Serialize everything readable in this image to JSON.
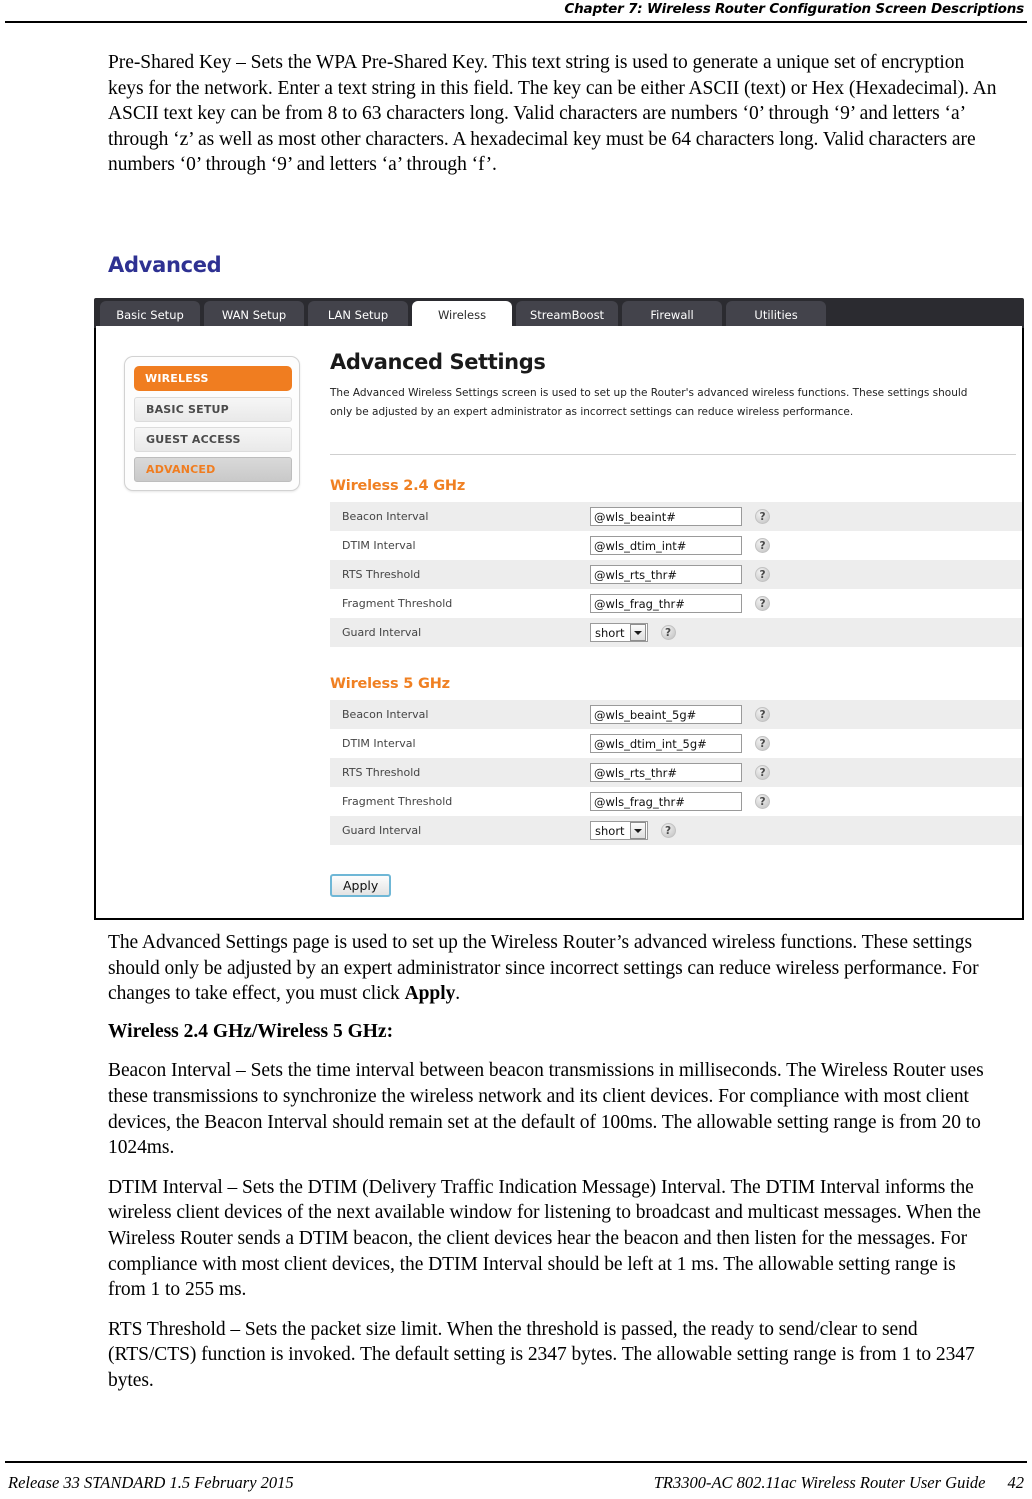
{
  "page_header": {
    "text": "Chapter 7: Wireless Router Configuration Screen Descriptions"
  },
  "intro": {
    "paragraph": "Pre-Shared Key – Sets the WPA Pre-Shared Key. This text string is used to generate a unique set of encryption keys for the network. Enter a text string in this field. The key can be either ASCII (text) or Hex (Hexadecimal). An ASCII text key can be from 8 to 63 characters long. Valid characters are numbers ‘0’ through ‘9’ and letters ‘a’ through ‘z’ as well as most other characters. A hexadecimal key must be 64 characters long. Valid characters are numbers ‘0’ through ‘9’ and letters ‘a’ through ‘f’."
  },
  "section": {
    "heading": "Advanced"
  },
  "router_ui": {
    "tabs": [
      {
        "label": "Basic Setup",
        "active": false
      },
      {
        "label": "WAN Setup",
        "active": false
      },
      {
        "label": "LAN Setup",
        "active": false
      },
      {
        "label": "Wireless",
        "active": true
      },
      {
        "label": "StreamBoost",
        "active": false
      },
      {
        "label": "Firewall",
        "active": false
      },
      {
        "label": "Utilities",
        "active": false
      }
    ],
    "sidebar": {
      "header": "WIRELESS",
      "items": [
        {
          "label": "BASIC SETUP",
          "selected": false
        },
        {
          "label": "GUEST ACCESS",
          "selected": false
        },
        {
          "label": "ADVANCED",
          "selected": true
        }
      ]
    },
    "pane": {
      "title": "Advanced Settings",
      "description": "The Advanced Wireless Settings screen is used to set up the Router's advanced wireless functions. These settings should only be adjusted by an expert administrator as incorrect settings can reduce wireless performance."
    },
    "group_24": {
      "title": "Wireless 2.4 GHz",
      "rows": [
        {
          "label": "Beacon Interval",
          "type": "text",
          "value": "@wls_beaint#",
          "help": "?"
        },
        {
          "label": "DTIM Interval",
          "type": "text",
          "value": "@wls_dtim_int#",
          "help": "?"
        },
        {
          "label": "RTS Threshold",
          "type": "text",
          "value": "@wls_rts_thr#",
          "help": "?"
        },
        {
          "label": "Fragment Threshold",
          "type": "text",
          "value": "@wls_frag_thr#",
          "help": "?"
        },
        {
          "label": "Guard Interval",
          "type": "select",
          "value": "short",
          "help": "?"
        }
      ]
    },
    "group_5": {
      "title": "Wireless 5 GHz",
      "rows": [
        {
          "label": "Beacon Interval",
          "type": "text",
          "value": "@wls_beaint_5g#",
          "help": "?"
        },
        {
          "label": "DTIM Interval",
          "type": "text",
          "value": "@wls_dtim_int_5g#",
          "help": "?"
        },
        {
          "label": "RTS Threshold",
          "type": "text",
          "value": "@wls_rts_thr#",
          "help": "?"
        },
        {
          "label": "Fragment Threshold",
          "type": "text",
          "value": "@wls_frag_thr#",
          "help": "?"
        },
        {
          "label": "Guard Interval",
          "type": "select",
          "value": "short",
          "help": "?"
        }
      ]
    },
    "apply_label": "Apply",
    "colors": {
      "accent_orange": "#f07d20",
      "tabbar_dark": "#2b2b30",
      "row_stripe": "#ededed",
      "apply_border": "#6fb7d6"
    }
  },
  "body": {
    "p_overview_1": "The Advanced Settings page is used to set up the Wireless Router’s advanced wireless functions.  These settings should only be adjusted by an expert administrator since incorrect settings can reduce wireless performance.  For changes to take effect, you must click ",
    "p_overview_bold": "Apply",
    "p_overview_end": ".",
    "subheading": "Wireless 2.4 GHz/Wireless 5 GHz:",
    "p_beacon": "Beacon Interval – Sets the time interval between beacon transmissions in milliseconds.  The Wireless Router uses these transmissions to synchronize the wireless network and its client devices.  For compliance with most client devices, the Beacon Interval should remain set at the default of 100ms.  The allowable setting range is from 20 to 1024ms.",
    "p_dtim": "DTIM Interval – Sets the DTIM (Delivery Traffic Indication Message) Interval.  The DTIM Interval informs the wireless client devices of the next available window for listening to broadcast and multicast messages.  When the Wireless Router sends a DTIM beacon, the client devices hear the beacon and then listen for the messages.  For compliance with most client devices, the DTIM Interval should be left at 1 ms.  The allowable setting range is from 1 to 255 ms.",
    "p_rts": "RTS Threshold – Sets the packet size limit.  When the threshold is passed, the ready to send/clear to send (RTS/CTS) function is invoked. The default setting is 2347 bytes.  The allowable setting range is from 1 to 2347 bytes."
  },
  "footer": {
    "left": "Release 33 STANDARD 1.5    February 2015",
    "right": "TR3300-AC 802.11ac Wireless Router User Guide",
    "page_number": "42"
  }
}
